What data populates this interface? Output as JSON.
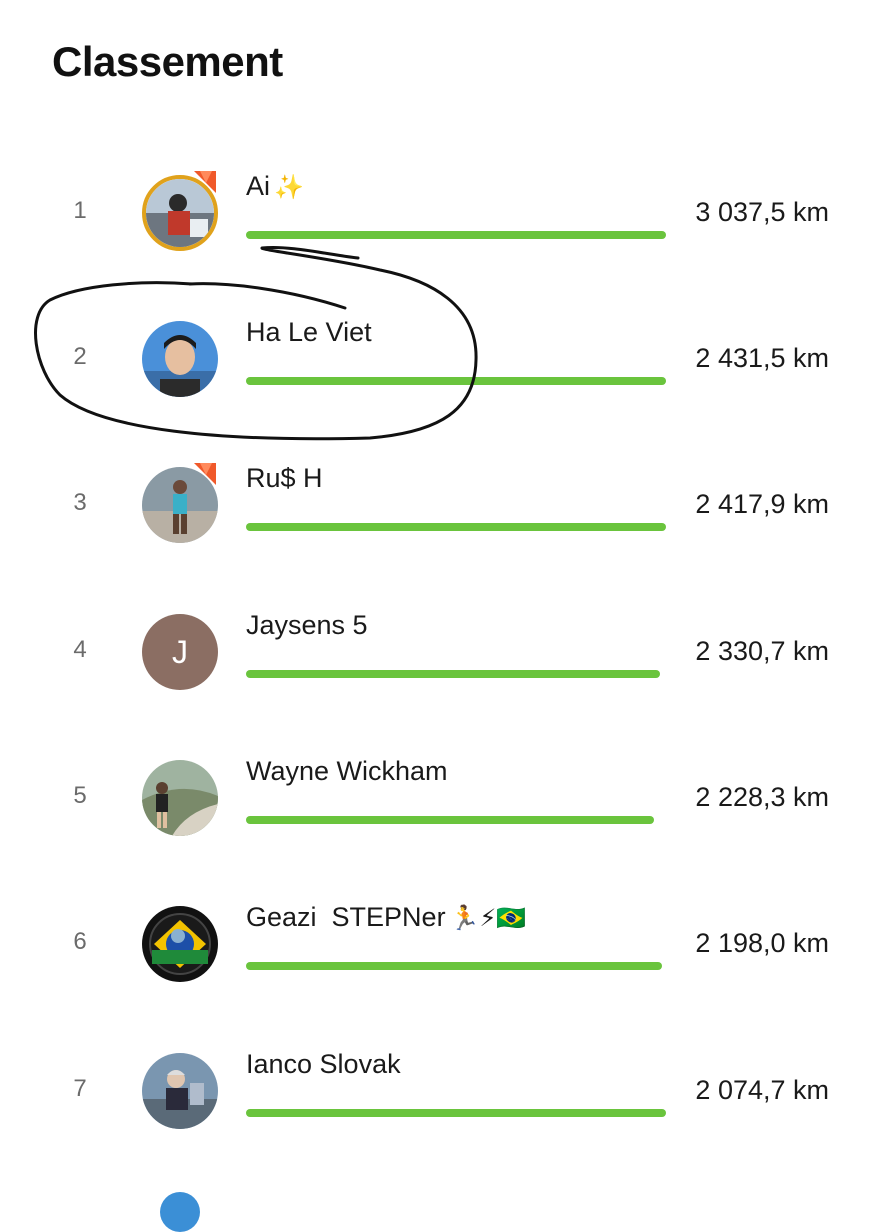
{
  "title": "Classement",
  "colors": {
    "bar": "#6ac43d",
    "badge": "#f0592a",
    "gold_ring": "#e0a21c"
  },
  "rows": [
    {
      "rank": "1",
      "name": "Ai",
      "emoji": "✨",
      "km": "3 037,5 km",
      "avatar": "photo",
      "badge": true
    },
    {
      "rank": "2",
      "name": "Ha Le Viet",
      "emoji": "",
      "km": "2 431,5 km",
      "avatar": "photo",
      "badge": false
    },
    {
      "rank": "3",
      "name": "Ru$ H",
      "emoji": "",
      "km": "2 417,9 km",
      "avatar": "photo",
      "badge": true
    },
    {
      "rank": "4",
      "name": "Jaysens 5",
      "emoji": "",
      "km": "2 330,7 km",
      "avatar": "letter",
      "avatar_letter": "J",
      "badge": false
    },
    {
      "rank": "5",
      "name": "Wayne Wickham",
      "emoji": "",
      "km": "2 228,3 km",
      "avatar": "photo",
      "badge": false
    },
    {
      "rank": "6",
      "name": "Geazi  STEPNer",
      "emoji": "🏃⚡🇧🇷",
      "km": "2 198,0 km",
      "avatar": "photo",
      "badge": false
    },
    {
      "rank": "7",
      "name": "Ianco Slovak",
      "emoji": "",
      "km": "2 074,7 km",
      "avatar": "photo",
      "badge": false
    }
  ]
}
